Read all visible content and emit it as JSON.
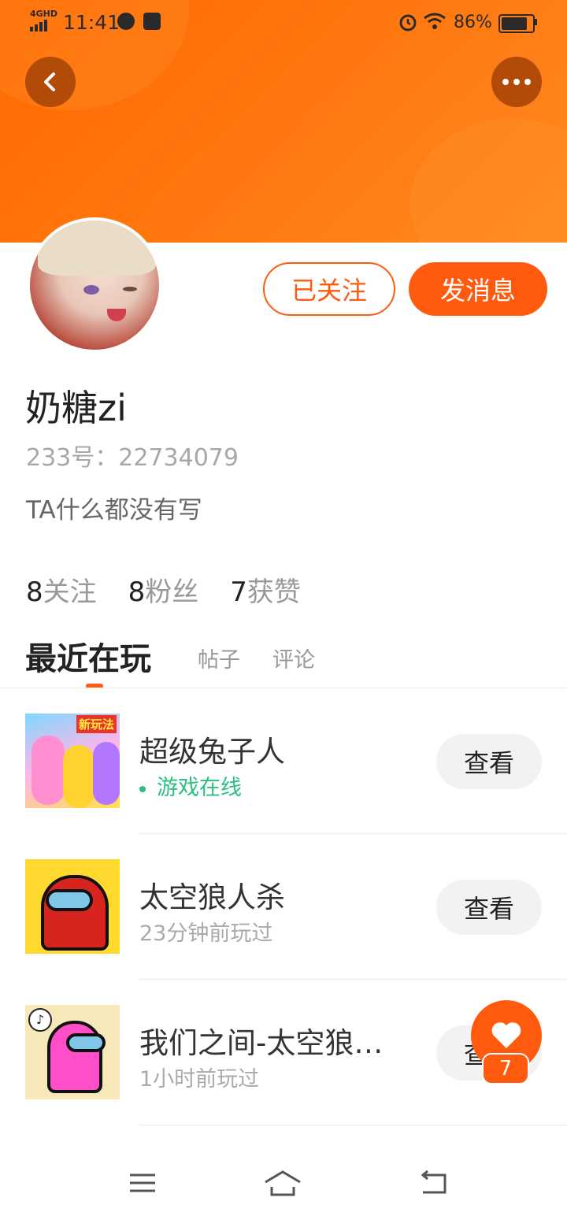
{
  "status_bar": {
    "network": "4GHD",
    "time": "11:41",
    "battery": "86%"
  },
  "profile": {
    "username": "奶糖zi",
    "uid": "233号：22734079",
    "bio": "TA什么都没有写",
    "follow_button": "已关注",
    "message_button": "发消息",
    "stats": [
      {
        "num": "8",
        "label": "关注"
      },
      {
        "num": "8",
        "label": "粉丝"
      },
      {
        "num": "7",
        "label": "获赞"
      }
    ]
  },
  "tabs": {
    "active": "最近在玩",
    "posts": "帖子",
    "comments": "评论"
  },
  "games": [
    {
      "name": "超级兔子人",
      "status": "游戏在线",
      "online": true,
      "button": "查看",
      "thumb_tag": "新玩法"
    },
    {
      "name": "太空狼人杀",
      "status": "23分钟前玩过",
      "online": false,
      "button": "查看"
    },
    {
      "name": "我们之间-太空狼…",
      "status": "1小时前玩过",
      "online": false,
      "button": "查看"
    }
  ],
  "fab": {
    "count": "7"
  },
  "colors": {
    "accent": "#ff5a0d",
    "online": "#2bbf80",
    "header": "#ff7a12"
  }
}
